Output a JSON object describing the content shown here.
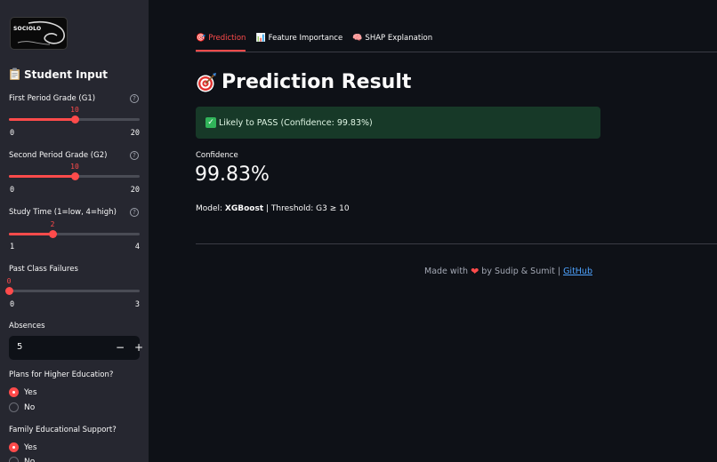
{
  "sidebar": {
    "logo_text": "SOCIOLO",
    "title": "Student Input",
    "title_icon": "clipboard-icon",
    "g1": {
      "label": "First Period Grade (G1)",
      "value": "10",
      "min": "0",
      "max": "20",
      "level": 0.5
    },
    "g2": {
      "label": "Second Period Grade (G2)",
      "value": "10",
      "min": "0",
      "max": "20",
      "level": 0.5
    },
    "studytime": {
      "label": "Study Time (1=low, 4=high)",
      "value": "2",
      "min": "1",
      "max": "4",
      "level": 0.3333
    },
    "failures": {
      "label": "Past Class Failures",
      "value": "0",
      "min": "0",
      "max": "3",
      "level": 0.0
    },
    "absences": {
      "label": "Absences",
      "value": "5",
      "minus": "−",
      "plus": "+"
    },
    "higher": {
      "label": "Plans for Higher Education?",
      "options": [
        "Yes",
        "No"
      ],
      "selected": "Yes"
    },
    "famsup": {
      "label": "Family Educational Support?",
      "options": [
        "Yes",
        "No"
      ],
      "selected": "Yes"
    },
    "help_glyph": "?"
  },
  "tabs": [
    {
      "label": "Prediction",
      "icon": "target-icon",
      "active": true
    },
    {
      "label": "Feature Importance",
      "icon": "bar-chart-icon",
      "active": false
    },
    {
      "label": "SHAP Explanation",
      "icon": "brain-icon",
      "active": false
    }
  ],
  "main": {
    "title": "Prediction Result",
    "alert": "Likely to PASS (Confidence: 99.83%)",
    "metric_label": "Confidence",
    "metric_value": "99.83%",
    "model_prefix": "Model: ",
    "model_name": "XGBoost",
    "model_suffix": " | Threshold: G3 ≥ 10"
  },
  "footer": {
    "made_with": "Made with",
    "by": "by Sudip & Sumit |",
    "link": "GitHub"
  },
  "colors": {
    "accent": "#ff4b4b",
    "success_bg": "#173928",
    "link": "#4ea3ff"
  }
}
